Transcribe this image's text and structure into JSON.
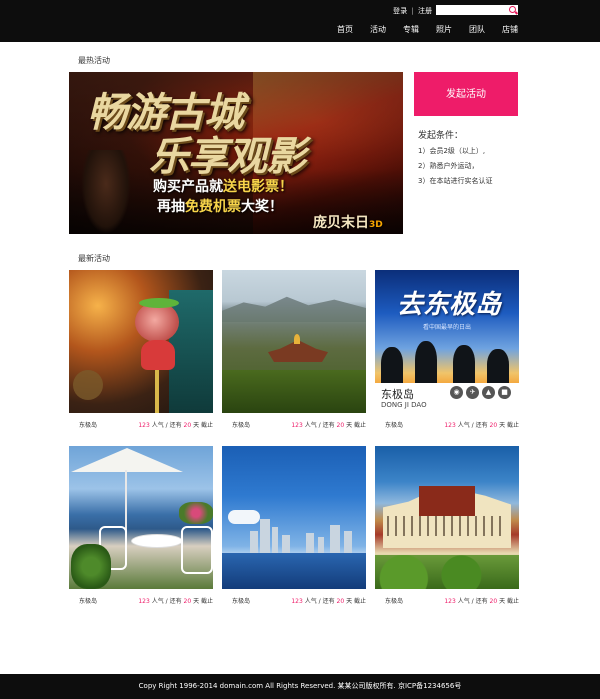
{
  "header": {
    "login": "登录",
    "register": "注册",
    "search_placeholder": "",
    "nav": [
      "首页",
      "活动",
      "专辑",
      "照片",
      "团队",
      "店铺"
    ]
  },
  "hot": {
    "section_title": "最热活动",
    "banner": {
      "line1": "畅游古城",
      "line2": "乐享观影",
      "promo1_a": "购买产品就",
      "promo1_b": "送电影票！",
      "promo2_a": "再抽",
      "promo2_b": "免费机票",
      "promo2_c": "大奖！",
      "movie": "庞贝末日",
      "movie_3d": "3D"
    },
    "launch_button": "发起活动",
    "conditions_title": "发起条件：",
    "conditions": [
      "1）会员2级（以上）,",
      "2）熟悉户外运动，",
      "3）在本站进行实名认证"
    ]
  },
  "latest": {
    "section_title": "最新活动",
    "overlay": {
      "title": "去东极岛",
      "subtitle": "看中国最早的日出",
      "name": "东极岛",
      "pinyin": "DONG JI DAO"
    },
    "cards": [
      {
        "name": "东极岛",
        "pop": "123",
        "pop_label": "人气 /",
        "left_label": "还有",
        "days": "20",
        "days_label": "天 截止"
      },
      {
        "name": "东极岛",
        "pop": "123",
        "pop_label": "人气 /",
        "left_label": "还有",
        "days": "20",
        "days_label": "天 截止"
      },
      {
        "name": "东极岛",
        "pop": "123",
        "pop_label": "人气 /",
        "left_label": "还有",
        "days": "20",
        "days_label": "天 截止"
      },
      {
        "name": "东极岛",
        "pop": "123",
        "pop_label": "人气 /",
        "left_label": "还有",
        "days": "20",
        "days_label": "天 截止"
      },
      {
        "name": "东极岛",
        "pop": "123",
        "pop_label": "人气 /",
        "left_label": "还有",
        "days": "20",
        "days_label": "天 截止"
      },
      {
        "name": "东极岛",
        "pop": "123",
        "pop_label": "人气 /",
        "left_label": "还有",
        "days": "20",
        "days_label": "天 截止"
      }
    ]
  },
  "footer": {
    "text": "Copy Right 1996-2014 domain.com All Rights Reserved. 某某公司版权所有. 京ICP备1234656号"
  },
  "colors": {
    "accent": "#ee1c69",
    "topbar": "#0d0d0d"
  }
}
